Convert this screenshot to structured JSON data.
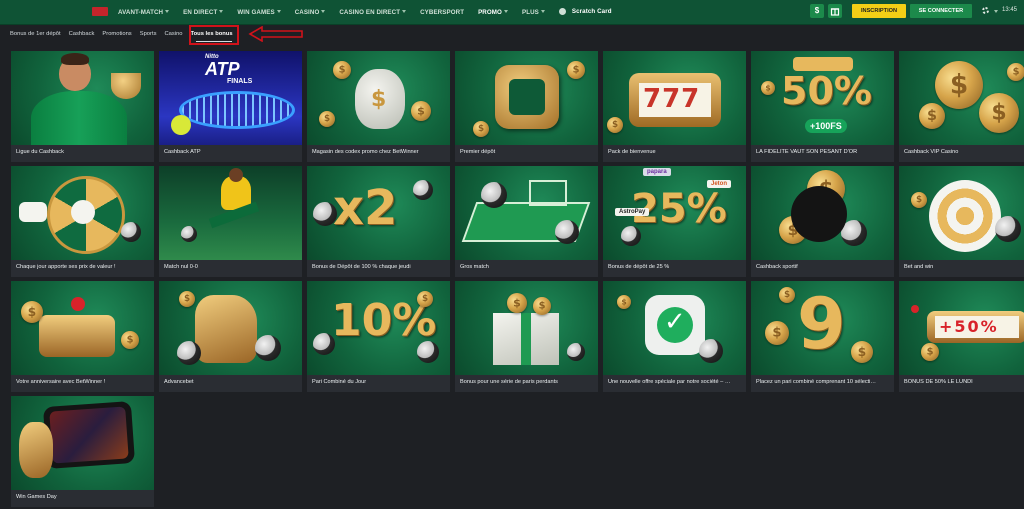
{
  "nav": {
    "items": [
      {
        "label": "AVANT-MATCH",
        "caret": true
      },
      {
        "label": "EN DIRECT",
        "caret": true
      },
      {
        "label": "WIN GAMES",
        "caret": true
      },
      {
        "label": "CASINO",
        "caret": true
      },
      {
        "label": "CASINO EN DIRECT",
        "caret": true
      },
      {
        "label": "CYBERSPORT",
        "caret": false
      },
      {
        "label": "PROMO",
        "caret": true,
        "active": true
      },
      {
        "label": "PLUS",
        "caret": true
      }
    ],
    "scratch_card": "Scratch Card",
    "register": "INSCRIPTION",
    "login": "SE CONNECTER",
    "time": "13:45",
    "dollar": "$",
    "colors": {
      "bar": "#0f5335",
      "register": "#f3cf16",
      "accent": "#1c8a4b"
    }
  },
  "tabs": [
    {
      "label": "Bonus de 1er dépôt"
    },
    {
      "label": "Cashback"
    },
    {
      "label": "Promotions"
    },
    {
      "label": "Sports"
    },
    {
      "label": "Casino"
    },
    {
      "label": "Tous les bonus",
      "active": true
    }
  ],
  "cards": [
    {
      "title": "Ligue du Cashback",
      "art": "player"
    },
    {
      "title": "Cashback ATP",
      "art": "atp",
      "art_text": "ATP",
      "art_sub": "FINALS",
      "art_top": "Nitto"
    },
    {
      "title": "Magasin des codex promo chez BetWinner",
      "art": "moneybag"
    },
    {
      "title": "Premier dépôt",
      "art": "safe"
    },
    {
      "title": "Pack de bienvenue",
      "art": "slot",
      "art_text": "777"
    },
    {
      "title": "LA FIDÉLITÉ VAUT SON PESANT D'OR",
      "art": "percent50",
      "art_text": "50%",
      "art_sub": "+100FS"
    },
    {
      "title": "Cashback VIP Casino",
      "art": "coins"
    },
    {
      "title": "Chaque jour apporte ses prix de valeur !",
      "art": "wheel"
    },
    {
      "title": "Match nul 0-0",
      "art": "kick"
    },
    {
      "title": "Bonus de Dépôt de 100 % chaque jeudi",
      "art": "x2",
      "art_text": "x2"
    },
    {
      "title": "Gros match",
      "art": "pitch"
    },
    {
      "title": "Bonus de dépôt de 25 %",
      "art": "p25",
      "art_text": "25%",
      "art_tag1": "papara",
      "art_tag2": "Jeton",
      "art_tag3": "AstroPay"
    },
    {
      "title": "Cashback sportif",
      "art": "sportcoins"
    },
    {
      "title": "Bet and win",
      "art": "target"
    },
    {
      "title": "Votre anniversaire avec BetWinner !",
      "art": "cake"
    },
    {
      "title": "Advancebet",
      "art": "thumb"
    },
    {
      "title": "Pari Combiné du Jour",
      "art": "p10",
      "art_text": "10%"
    },
    {
      "title": "Bonus pour une série de paris perdants",
      "art": "gift"
    },
    {
      "title": "Une nouvelle offre spéciale par notre société – …",
      "art": "check"
    },
    {
      "title": "Placez un pari combiné comprenant 10 sélecti…",
      "art": "nine",
      "art_text": "9"
    },
    {
      "title": "BONUS DE 50% LE LUNDI",
      "art": "slot50",
      "art_text": "+50%"
    },
    {
      "title": "Win Games Day",
      "art": "phone"
    }
  ]
}
